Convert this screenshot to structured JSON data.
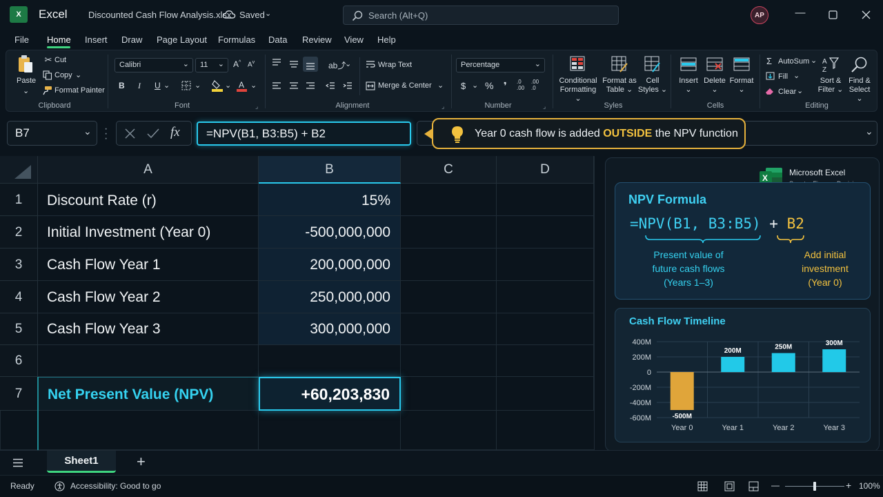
{
  "window": {
    "app_name": "Excel",
    "app_icon_letter": "X",
    "file_name": "Discounted Cash Flow Analysis.xlsx",
    "save_status": "Saved",
    "search_placeholder": "Search (Alt+Q)",
    "user_initials": "AP"
  },
  "menu": {
    "tabs": [
      "File",
      "Home",
      "Insert",
      "Draw",
      "Page Layout",
      "Formulas",
      "Data",
      "Review",
      "View",
      "Help"
    ],
    "active_tab": "Home"
  },
  "ribbon": {
    "clipboard": {
      "label": "Clipboard",
      "paste": "Paste",
      "cut": "Cut",
      "copy": "Copy",
      "format_painter": "Format Painter"
    },
    "font": {
      "label": "Font",
      "font_name": "Calibri",
      "font_size": "11",
      "bold": "B",
      "italic": "I",
      "underline": "U"
    },
    "alignment": {
      "label": "Alignment",
      "wrap_text": "Wrap Text",
      "merge_center": "Merge & Center"
    },
    "number": {
      "label": "Number",
      "format": "Percentage",
      "currency": "$",
      "percent": "%",
      "comma": "❜"
    },
    "styles": {
      "label": "Syles",
      "conditional": [
        "Conditional",
        "Formatting"
      ],
      "format_table": [
        "Format as",
        "Table"
      ],
      "cell_styles": [
        "Cell",
        "Styles"
      ]
    },
    "cells": {
      "label": "Cells",
      "insert": "Insert",
      "delete": "Delete",
      "format": "Format"
    },
    "editing": {
      "label": "Editing",
      "autosum": "AutoSum",
      "fill": "Fill",
      "clear": "Clear",
      "sort_filter": [
        "Sort &",
        "Filter"
      ],
      "find_select": [
        "Find &",
        "Select"
      ]
    }
  },
  "formula_bar": {
    "name_box": "B7",
    "fx": "fx",
    "formula": "=NPV(B1, B3:B5) + B2",
    "callout_pre": "Year 0 cash flow is added ",
    "callout_highlight": "OUTSIDE",
    "callout_post": " the NPV function"
  },
  "sheet": {
    "columns": [
      "A",
      "B",
      "C",
      "D"
    ],
    "rows": [
      {
        "num": "1",
        "a": "Discount Rate (r)",
        "b": "15%"
      },
      {
        "num": "2",
        "a": "Initial Investment (Year 0)",
        "b": "-500,000,000"
      },
      {
        "num": "3",
        "a": "Cash Flow Year 1",
        "b": "200,000,000"
      },
      {
        "num": "4",
        "a": "Cash Flow Year 2",
        "b": "250,000,000"
      },
      {
        "num": "5",
        "a": "Cash Flow Year 3",
        "b": "300,000,000"
      },
      {
        "num": "6",
        "a": "",
        "b": ""
      },
      {
        "num": "7",
        "a": "Net Present Value (NPV)",
        "b": "+60,203,830"
      }
    ]
  },
  "panel": {
    "brand_title": "Microsoft Excel",
    "brand_sub": "Smarter Finance Decisions",
    "npv_card": {
      "title": "NPV Formula",
      "formula_main": "=NPV(B1, B3:B5)",
      "formula_plus": " + ",
      "formula_b2": "B2",
      "note_left": [
        "Present value of",
        "future cash flows",
        "(Years 1–3)"
      ],
      "note_right": [
        "Add initial",
        "investment",
        "(Year 0)"
      ]
    },
    "timeline_title": "Cash Flow Timeline"
  },
  "chart_data": {
    "type": "bar",
    "title": "Cash Flow Timeline",
    "categories": [
      "Year 0",
      "Year 1",
      "Year 2",
      "Year 3"
    ],
    "values": [
      -500,
      200,
      250,
      300
    ],
    "data_labels": [
      "-500M",
      "200M",
      "250M",
      "300M"
    ],
    "y_ticks": [
      400,
      200,
      0,
      -200,
      -400,
      -600
    ],
    "y_tick_labels": [
      "400M",
      "200M",
      "0",
      "-200M",
      "-400M",
      "-600M"
    ],
    "ylim": [
      -600,
      400
    ],
    "colors": {
      "negative": "#e0a53a",
      "positive": "#22c9e8"
    },
    "grid": true
  },
  "sheet_tabs": {
    "active": "Sheet1",
    "add": "+"
  },
  "status": {
    "ready": "Ready",
    "accessibility": "Accessibility: Good to go",
    "zoom": "100%",
    "minus": "—",
    "plus": "+"
  },
  "colors": {
    "accent_cyan": "#29c9ec",
    "accent_gold": "#e7b23c",
    "excel_green": "#1d7a45"
  }
}
